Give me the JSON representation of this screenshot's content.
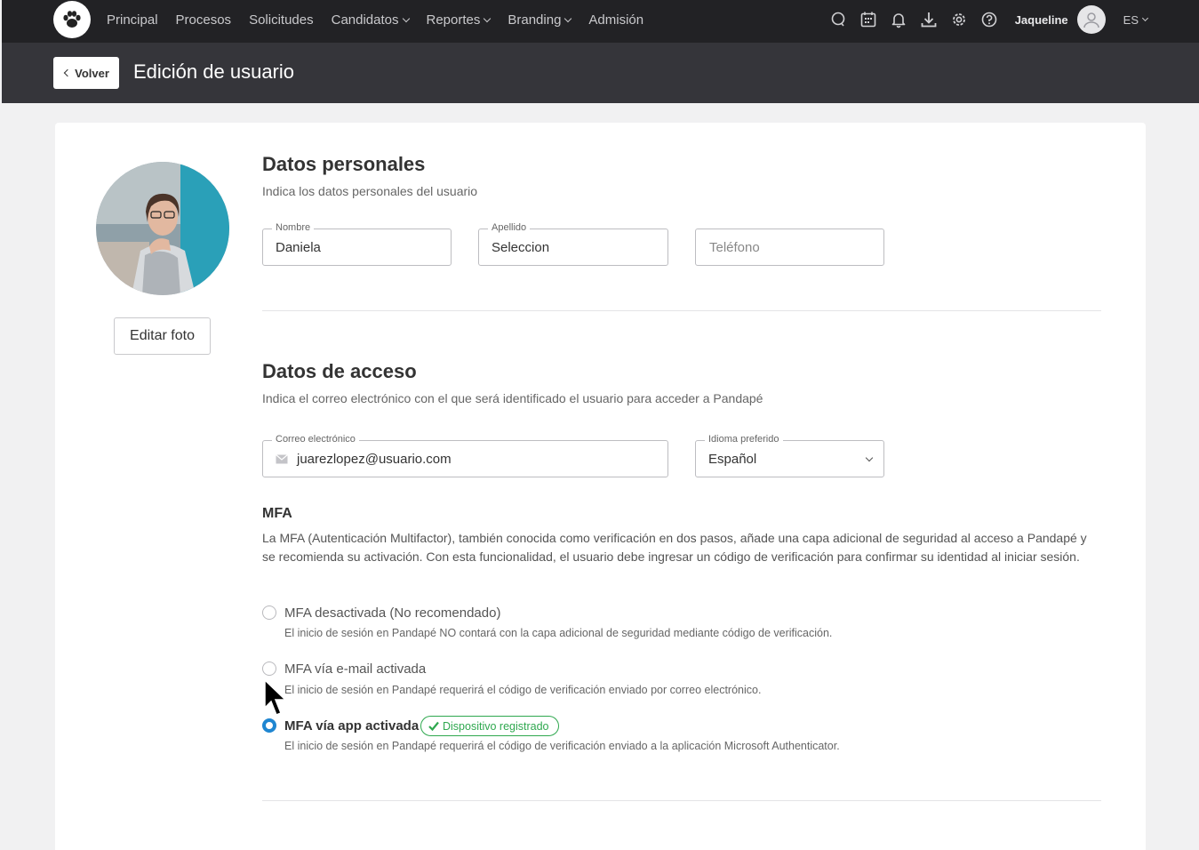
{
  "nav": {
    "items": [
      {
        "label": "Principal",
        "dropdown": false
      },
      {
        "label": "Procesos",
        "dropdown": false
      },
      {
        "label": "Solicitudes",
        "dropdown": false
      },
      {
        "label": "Candidatos",
        "dropdown": true
      },
      {
        "label": "Reportes",
        "dropdown": true
      },
      {
        "label": "Branding",
        "dropdown": true
      },
      {
        "label": "Admisión",
        "dropdown": false
      }
    ],
    "icons": [
      "chat-icon",
      "calendar-icon",
      "bell-icon",
      "download-icon",
      "gear-icon",
      "help-icon"
    ],
    "user_name": "Jaqueline",
    "language": "ES"
  },
  "header": {
    "back_label": "Volver",
    "title": "Edición de usuario"
  },
  "profile": {
    "edit_photo_label": "Editar foto"
  },
  "personal": {
    "title": "Datos personales",
    "subtitle": "Indica los datos personales del usuario",
    "name_label": "Nombre",
    "name_value": "Daniela",
    "lastname_label": "Apellido",
    "lastname_value": "Seleccion",
    "phone_placeholder": "Teléfono"
  },
  "access": {
    "title": "Datos de acceso",
    "subtitle": "Indica el correo electrónico con el que será identificado el usuario para acceder a Pandapé",
    "email_label": "Correo electrónico",
    "email_value": "juarezlopez@usuario.com",
    "language_label": "Idioma preferido",
    "language_value": "Español"
  },
  "mfa": {
    "title": "MFA",
    "description": "La MFA (Autenticación Multifactor), también conocida como verificación en dos pasos, añade una capa adicional de seguridad al acceso a Pandapé y se recomienda su activación. Con esta funcionalidad, el usuario debe ingresar un código de verificación para confirmar su identidad al iniciar sesión.",
    "options": [
      {
        "label": "MFA desactivada (No recomendado)",
        "help": "El inicio de sesión en Pandapé NO contará con la capa adicional de seguridad mediante código de verificación.",
        "checked": false
      },
      {
        "label": "MFA vía e-mail activada",
        "help": "El inicio de sesión en Pandapé requerirá el código de verificación enviado por correo electrónico.",
        "checked": false
      },
      {
        "label": "MFA vía app activada",
        "help": "El inicio de sesión en Pandapé requerirá el código de verificación enviado a la aplicación Microsoft Authenticator.",
        "checked": true
      }
    ],
    "badge": "Dispositivo registrado"
  },
  "colors": {
    "nav_bg": "#222225",
    "subheader_bg": "#35353a",
    "accent": "#1f86d1",
    "success": "#2fa84f"
  }
}
